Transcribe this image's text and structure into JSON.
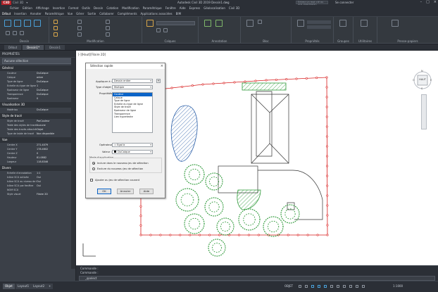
{
  "app": {
    "window_title": "Autodesk Civil 3D 2019   Dessin1.dwg",
    "search_placeholder": "Entrez un mot clé ou une expression",
    "signin": "Se connecter",
    "appmenu": "C3D"
  },
  "qat": [
    "Civil 3D",
    "▾"
  ],
  "menubar": [
    "Fichier",
    "Edition",
    "Affichage",
    "Insertion",
    "Format",
    "Outils",
    "Dessin",
    "Cotation",
    "Modification",
    "Paramétrique",
    "Fenêtre",
    "Aide",
    "Express",
    "Géolocalisation",
    "Civil 3D"
  ],
  "ribbon_tabs": [
    "Début",
    "Insertion",
    "Annoter",
    "Paramétrique",
    "Vue",
    "Gérer",
    "Sortie",
    "Collaborer",
    "Compléments",
    "Applications associées",
    "BIM"
  ],
  "ribbon_panels": [
    "Dessin",
    "Modification",
    "Calques",
    "Annotation",
    "Bloc",
    "Propriétés",
    "Groupes",
    "Utilitaires",
    "Presse-papiers"
  ],
  "file_tabs": [
    "Début",
    "Dessin1*",
    "Dessin1"
  ],
  "properties": {
    "title": "PROPRIÉTÉS",
    "selection": "Aucune sélection",
    "sections": [
      {
        "name": "Général",
        "rows": [
          {
            "k": "Couleur",
            "v": "DuCalque"
          },
          {
            "k": "Calque",
            "v": "arbre"
          },
          {
            "k": "Type de ligne",
            "v": "DuCalque"
          },
          {
            "k": "Echelle du type de ligne",
            "v": "1"
          },
          {
            "k": "Epaisseur de ligne",
            "v": "DuCalque"
          },
          {
            "k": "Transparence",
            "v": "DuCalque"
          },
          {
            "k": "Epaisseur",
            "v": "0"
          }
        ]
      },
      {
        "name": "Visualisation 3D",
        "rows": [
          {
            "k": "Matériau",
            "v": "DuCalque"
          }
        ]
      },
      {
        "name": "Style de tracé",
        "rows": [
          {
            "k": "Style de tracé",
            "v": "ParCouleur"
          },
          {
            "k": "Table des styles de tracé",
            "v": "Aucune"
          },
          {
            "k": "Table des tracés attachés",
            "v": "Objet"
          },
          {
            "k": "Type de table de tracé",
            "v": "Non disponible"
          }
        ]
      },
      {
        "name": "Vue",
        "rows": [
          {
            "k": "Centre X",
            "v": "271.4079"
          },
          {
            "k": "Centre Y",
            "v": "178.4602"
          },
          {
            "k": "Centre Z",
            "v": "0"
          },
          {
            "k": "Hauteur",
            "v": "81.0882"
          },
          {
            "k": "Largeur",
            "v": "118.8346"
          }
        ]
      },
      {
        "name": "Divers",
        "rows": [
          {
            "k": "Echelle d'annotation",
            "v": "1:1"
          },
          {
            "k": "Icône SCU activée",
            "v": "Oui"
          },
          {
            "k": "Icône SCU au niveau de l'origine",
            "v": "Oui"
          },
          {
            "k": "Icône SCU par fenêtre",
            "v": "Oui"
          },
          {
            "k": "NOM SCU",
            "v": ""
          },
          {
            "k": "Style visuel",
            "v": "Filaire 2D"
          }
        ]
      }
    ]
  },
  "viewport_label": "[-][Haut][Filaire 2D]",
  "viewcube": {
    "face": "HAUT",
    "n": "N",
    "s": "S",
    "w": "O",
    "e": "E"
  },
  "dialog": {
    "title": "Sélection rapide",
    "apply_to_label": "Appliquer à :",
    "apply_to_value": "Dessin entier",
    "object_type_label": "Type d'objet :",
    "object_type_value": "Multiple",
    "properties_label": "Propriétés :",
    "properties_list": [
      "Couleur",
      "Calque",
      "Type de ligne",
      "Echelle du type de ligne",
      "Style de tracé",
      "Epaisseur de ligne",
      "Transparence",
      "Lien hypertexte"
    ],
    "selected_property": "Couleur",
    "operator_label": "Opérateur :",
    "operator_value": "= Egal à",
    "value_label": "Valeur :",
    "value_value": "DuCalque",
    "mode_label": "Mode d'application",
    "mode_include": "Inclure dans le nouveau jeu de sélection",
    "mode_exclude": "Exclure du nouveau jeu de sélection",
    "append_label": "Ajouter au jeu de sélection courant",
    "ok": "OK",
    "cancel": "Annuler",
    "help": "Aide"
  },
  "command": {
    "line1": "Commande :",
    "line2": "Commande :",
    "prompt": "_qselect"
  },
  "layout_tabs": [
    "Objet",
    "Layout1",
    "Layout2",
    "+"
  ],
  "status": {
    "mode": "OBJET",
    "scale": "1:1000"
  },
  "colors": {
    "accent": "#0a64c8",
    "hatch_blue": "#2b5fa8",
    "hatch_green": "#2f9a3a",
    "boundary_red": "#d81b1b"
  }
}
